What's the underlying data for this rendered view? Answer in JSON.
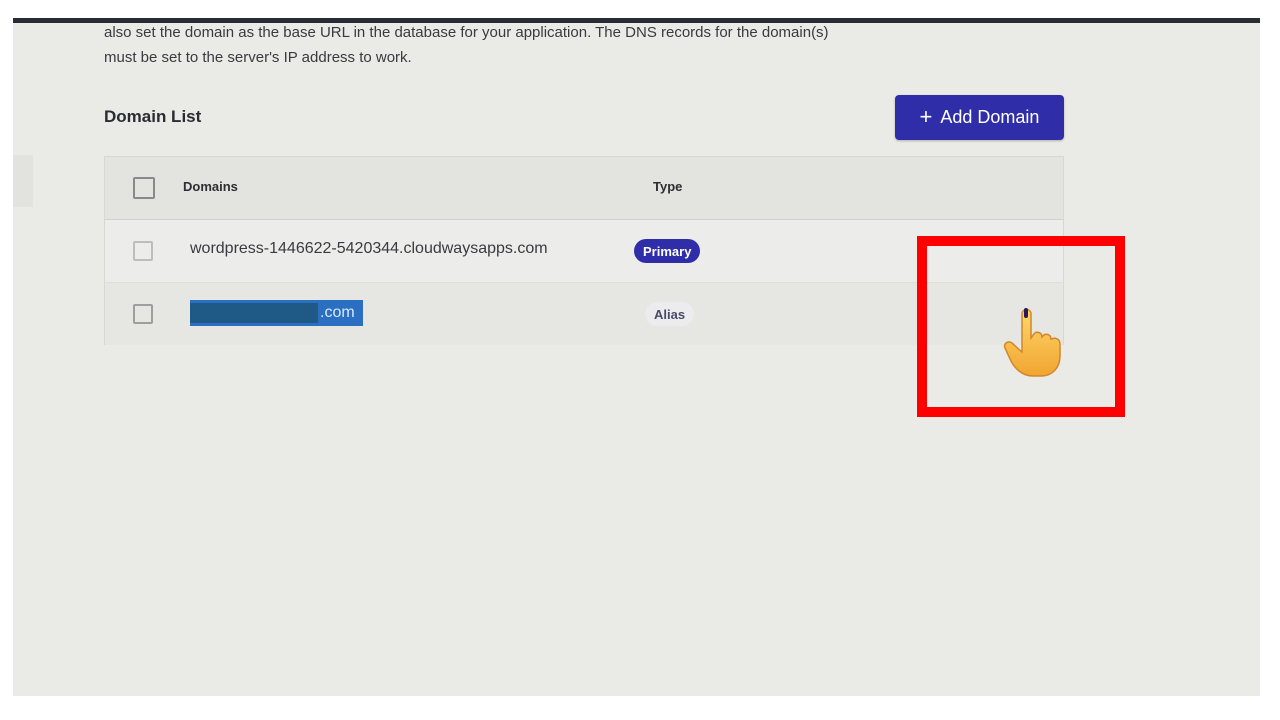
{
  "description": {
    "line1": "also set the domain as the base URL in the database for your application. The DNS records for the domain(s)",
    "line2": "must be set to the server's IP address to work."
  },
  "domain_list": {
    "title": "Domain List",
    "add_button_label": "Add Domain",
    "add_button_icon": "plus-icon",
    "columns": [
      "Domains",
      "Type"
    ],
    "rows": [
      {
        "domain": "wordpress-1446622-5420344.cloudwaysapps.com",
        "type": "Primary",
        "selected_text": false
      },
      {
        "domain_visible_suffix": ".com",
        "type": "Alias",
        "selected_text": true
      }
    ]
  },
  "colors": {
    "accent": "#2f2ea8",
    "highlight_border": "#ff0000",
    "text_selection": "#2a6fc2",
    "page_background": "#eaeae6"
  },
  "overlay": {
    "cursor_icon": "pointing-hand-cursor-icon"
  }
}
